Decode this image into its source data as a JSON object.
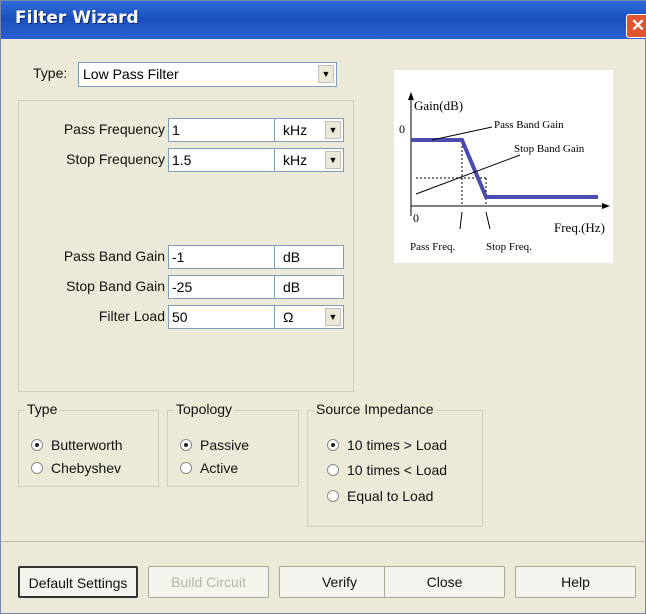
{
  "window": {
    "title": "Filter Wizard",
    "close_glyph": "✕"
  },
  "type_select": {
    "label": "Type:",
    "value": "Low Pass Filter"
  },
  "params": [
    {
      "label": "Pass Frequency",
      "value": "1",
      "unit": "kHz",
      "has_dropdown": true
    },
    {
      "label": "Stop Frequency",
      "value": "1.5",
      "unit": "kHz",
      "has_dropdown": true
    },
    {
      "label": "Pass Band Gain",
      "value": "-1",
      "unit": "dB",
      "has_dropdown": false
    },
    {
      "label": "Stop Band Gain",
      "value": "-25",
      "unit": "dB",
      "has_dropdown": false
    },
    {
      "label": "Filter Load",
      "value": "50",
      "unit": "Ω",
      "has_dropdown": true
    }
  ],
  "graph": {
    "y_label": "Gain(dB)",
    "x_label": "Freq.(Hz)",
    "origin_y": "0",
    "origin_x": "0",
    "pass_band_gain": "Pass Band Gain",
    "stop_band_gain": "Stop Band Gain",
    "pass_freq": "Pass Freq.",
    "stop_freq": "Stop Freq.",
    "curve_color": "#4b4bb0"
  },
  "type_group": {
    "legend": "Type",
    "options": [
      {
        "label": "Butterworth",
        "selected": true
      },
      {
        "label": "Chebyshev",
        "selected": false
      }
    ]
  },
  "topology_group": {
    "legend": "Topology",
    "options": [
      {
        "label": "Passive",
        "selected": true
      },
      {
        "label": "Active",
        "selected": false
      }
    ]
  },
  "source_group": {
    "legend": "Source Impedance",
    "options": [
      {
        "label": "10 times > Load",
        "selected": true
      },
      {
        "label": "10 times < Load",
        "selected": false
      },
      {
        "label": "Equal to Load",
        "selected": false
      }
    ]
  },
  "buttons": {
    "default_settings": "Default Settings",
    "build_circuit": "Build Circuit",
    "verify": "Verify",
    "close": "Close",
    "help": "Help"
  }
}
